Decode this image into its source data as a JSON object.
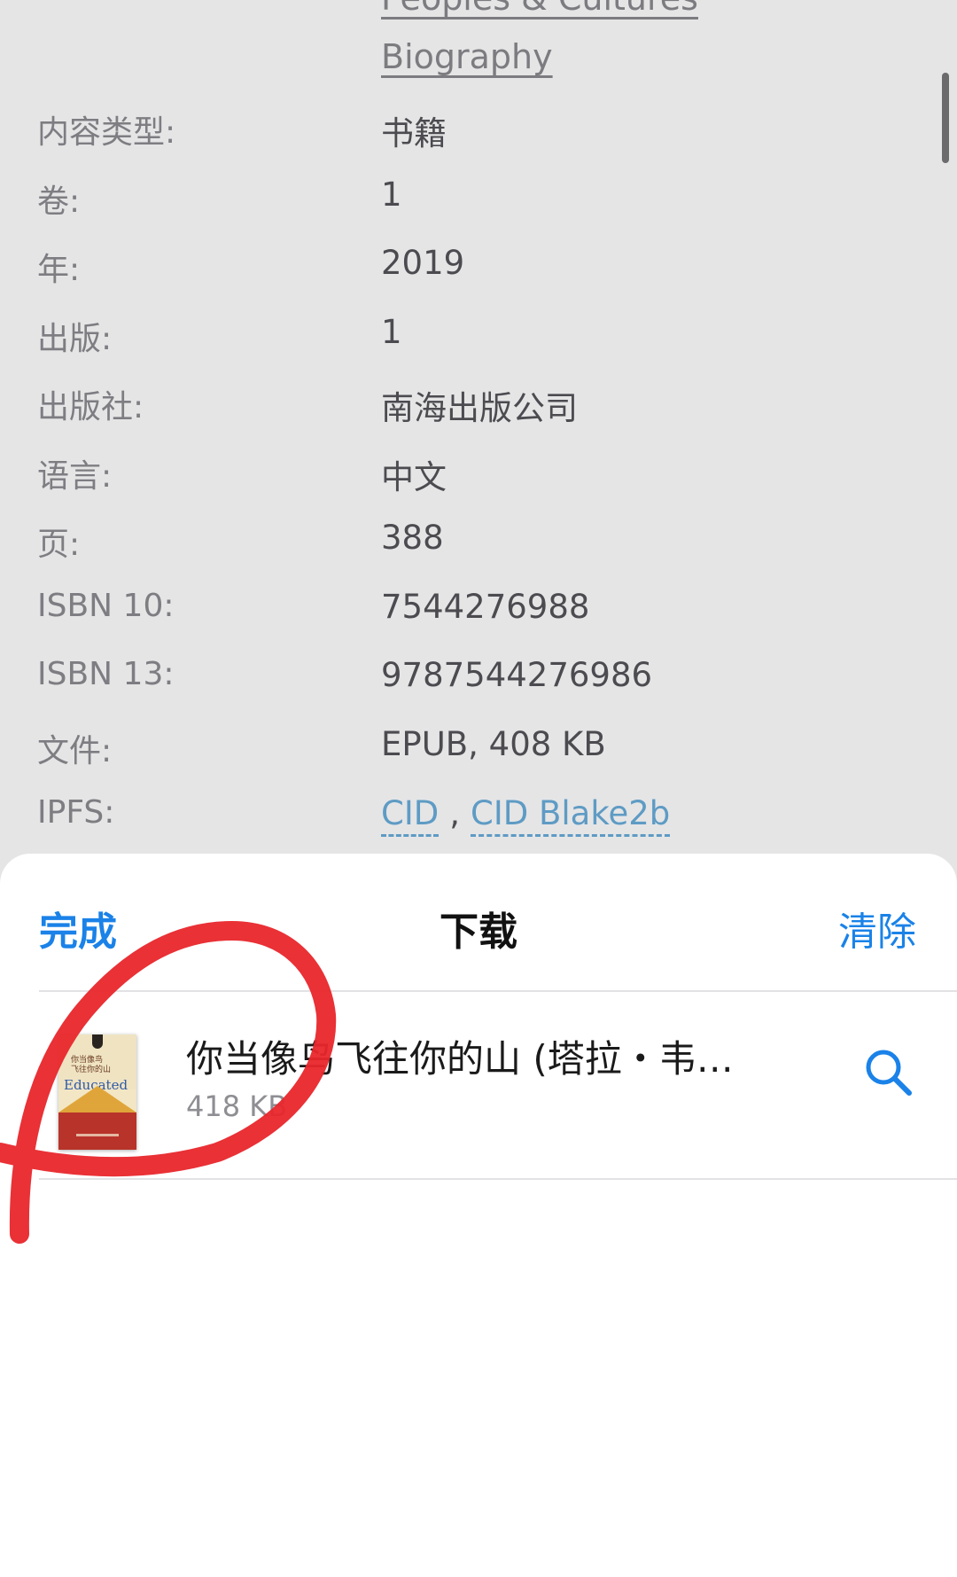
{
  "detail": {
    "top_link_cut": "Peoples & Cultures",
    "top_link": "Biography",
    "rows": [
      {
        "label": "内容类型:",
        "value": "书籍"
      },
      {
        "label": "卷:",
        "value": "1"
      },
      {
        "label": "年:",
        "value": "2019"
      },
      {
        "label": "出版:",
        "value": "1"
      },
      {
        "label": "出版社:",
        "value": "南海出版公司"
      },
      {
        "label": "语言:",
        "value": "中文"
      },
      {
        "label": "页:",
        "value": "388"
      },
      {
        "label": "ISBN 10:",
        "value": "7544276988"
      },
      {
        "label": "ISBN 13:",
        "value": "9787544276986"
      },
      {
        "label": "文件:",
        "value": "EPUB, 408 KB"
      }
    ],
    "ipfs": {
      "label": "IPFS:",
      "link1": "CID",
      "separator": ",",
      "link2": "CID Blake2b"
    }
  },
  "sheet": {
    "done_label": "完成",
    "title": "下载",
    "clear_label": "清除",
    "download": {
      "title": "你当像鸟飞往你的山 (塔拉・韦…",
      "size": "418 KB",
      "cover_title_cn": "你当像鸟\n飞往你的山",
      "cover_title_en": "Educated"
    },
    "search_icon": "search-icon"
  },
  "colors": {
    "accent": "#1a82e8",
    "link": "#5e9bc4",
    "annotation": "#e8262b"
  }
}
